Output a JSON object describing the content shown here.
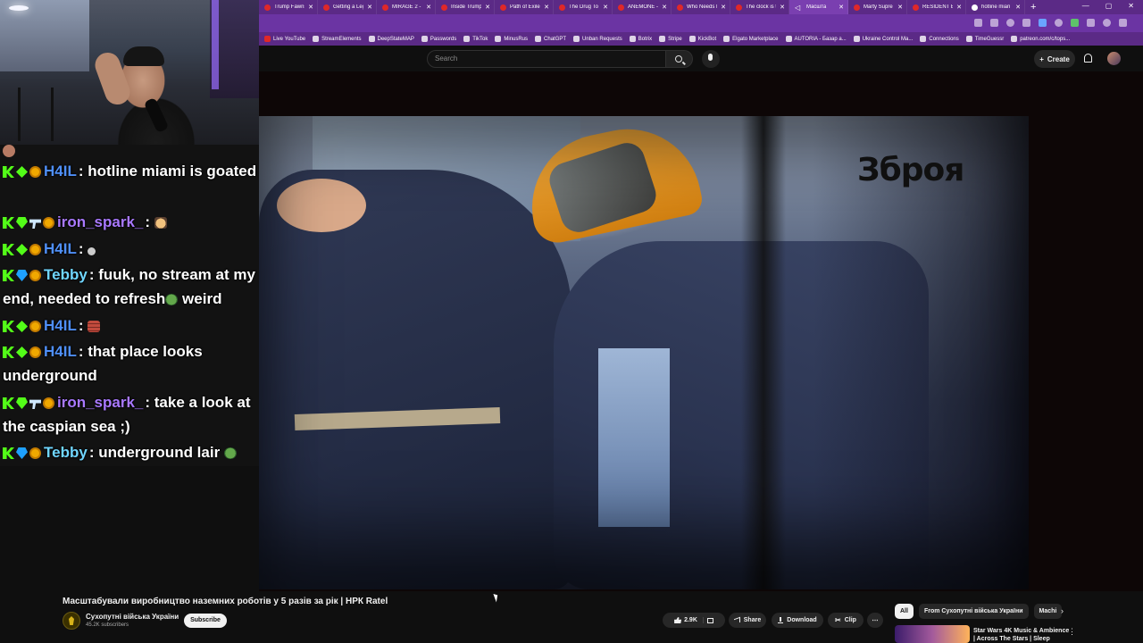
{
  "browser": {
    "tabs": [
      {
        "title": "Trump Fawns"
      },
      {
        "title": "Getting a Leg"
      },
      {
        "title": "MIRAGE 2 - R"
      },
      {
        "title": "Inside Trump"
      },
      {
        "title": "Path of Exile"
      },
      {
        "title": "The Drug To"
      },
      {
        "title": "ANEMONE - ."
      },
      {
        "title": "Who Needs F"
      },
      {
        "title": "The clock is ti"
      },
      {
        "title": "Масшта",
        "active": true,
        "muted": true
      },
      {
        "title": "Marty Supre"
      },
      {
        "title": "RESIDENT EV"
      },
      {
        "title": "hotline mian"
      }
    ],
    "new_tab_glyph": "+",
    "window_controls": [
      "—",
      "▢",
      "✕"
    ],
    "bookmarks": [
      "Live YouTube",
      "StreamElements",
      "DeepStateMAP",
      "Passwords",
      "TikTok",
      "MinusRus",
      "ChatGPT",
      "Unban Requests",
      "Botrix",
      "Stripe",
      "KickBot",
      "Elgato Marketplace",
      "AUTORIA - Базар а...",
      "Ukraine Control Ma...",
      "Connections",
      "TimeGuessr",
      "patreon.com/c/tops..."
    ]
  },
  "youtube": {
    "search_placeholder": "Search",
    "create_label": "Create",
    "video_title": "Масштабували виробництво наземних роботів у 5 разів за рік | НРК Ratel",
    "channel_name": "Сухопутні війська України",
    "channel_subs": "45.2K subscribers",
    "subscribe_label": "Subscribe",
    "likes": "2.9K",
    "share_label": "Share",
    "download_label": "Download",
    "clip_label": "Clip",
    "video_overlay_logo": "Зброя",
    "chips": [
      "All",
      "From Сухопутні війська України",
      "Machi"
    ],
    "recommended_title": "Star Wars 4K Music & Ambience | Across The Stars | Sleep"
  },
  "chat": {
    "messages": [
      {
        "user": "H4IL",
        "text": ": hotline miami is goated",
        "color": "blue"
      },
      {
        "user": "iron_spark_",
        "text": ":",
        "color": "purple"
      },
      {
        "user": "H4IL",
        "text": ":",
        "color": "blue"
      },
      {
        "user": "Tebby",
        "text": ": fuuk, no stream at my end, needed to refresh",
        "suffix": " weird",
        "color": "teal"
      },
      {
        "user": "H4IL",
        "text": ":",
        "color": "blue"
      },
      {
        "user": "H4IL",
        "text": ": that place looks underground",
        "color": "blue"
      },
      {
        "user": "iron_spark_",
        "text": ": take a look at the caspian sea ;)",
        "color": "purple"
      },
      {
        "user": "Tebby",
        "text": ": underground lair",
        "color": "teal"
      }
    ]
  },
  "colors": {
    "browser_frame": "#5b2a86",
    "youtube_bg": "#0f0f0f",
    "kick_green": "#53fc18"
  }
}
